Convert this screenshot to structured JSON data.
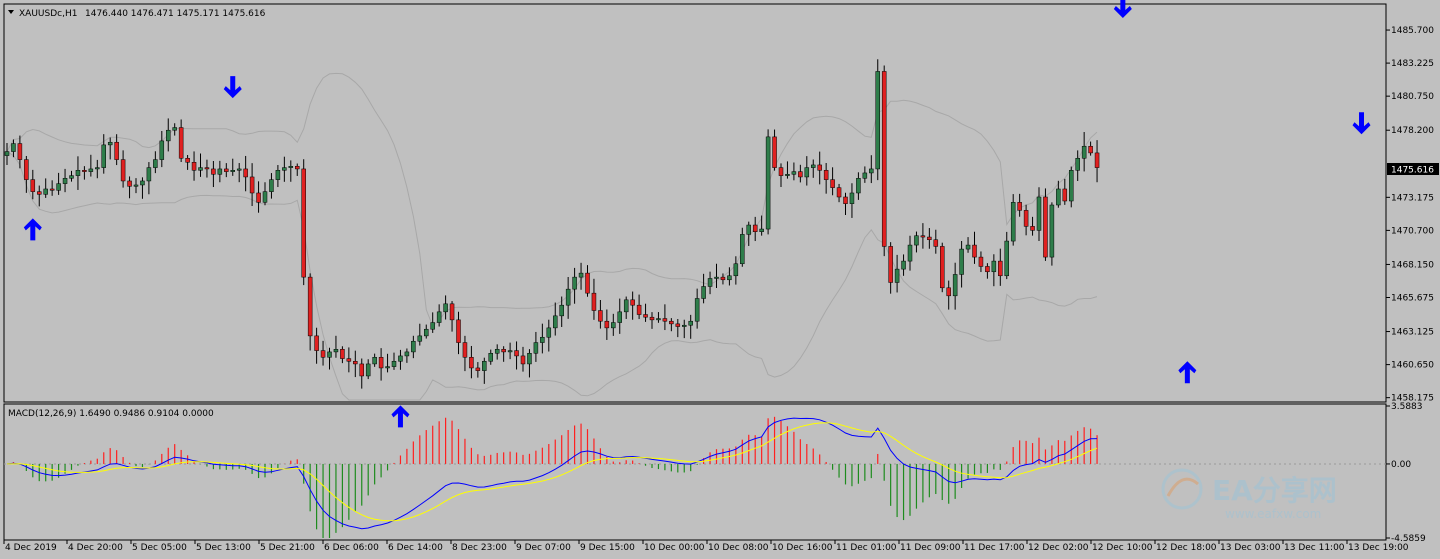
{
  "window": {
    "symbol_label": "XAUUSDc,H1",
    "ohlc_label": "1476.440 1476.471 1475.171 1475.616",
    "current_price_label": "1475.616"
  },
  "colors": {
    "background": "#c0c0c0",
    "bull_candle": "#2e7d4a",
    "bear_candle": "#e02020",
    "arrow": "#0000ff",
    "bands": "#a8a8a8",
    "macd_line": "#0000ff",
    "signal_line": "#ffff00",
    "hist_positive": "#ff2020",
    "hist_negative": "#1e8c1e"
  },
  "indicator": {
    "label": "MACD(12,26,9) 1.6490 0.9486 0.9104 0.0000"
  },
  "watermark": {
    "brand": "EA分享网",
    "url": "www.eafxw.com"
  },
  "chart_data": [
    {
      "type": "candlestick",
      "title": "XAUUSDc,H1",
      "y_ticks": [
        "1485.700",
        "1483.225",
        "1480.750",
        "1478.200",
        "1475.616",
        "1473.175",
        "1470.700",
        "1468.150",
        "1465.675",
        "1463.125",
        "1460.650",
        "1458.175"
      ],
      "ylim": [
        1458.0,
        1487.5
      ],
      "x_ticks": [
        "4 Dec 2019",
        "4 Dec 20:00",
        "5 Dec 05:00",
        "5 Dec 13:00",
        "5 Dec 21:00",
        "6 Dec 06:00",
        "6 Dec 14:00",
        "8 Dec 23:00",
        "9 Dec 07:00",
        "9 Dec 15:00",
        "10 Dec 00:00",
        "10 Dec 08:00",
        "10 Dec 16:00",
        "11 Dec 01:00",
        "11 Dec 09:00",
        "11 Dec 17:00",
        "12 Dec 02:00",
        "12 Dec 10:00",
        "12 Dec 18:00",
        "13 Dec 03:00",
        "13 Dec 11:00",
        "13 Dec 19:00"
      ],
      "closes": [
        1476.6,
        1477.2,
        1476.0,
        1474.5,
        1473.6,
        1473.4,
        1473.8,
        1473.7,
        1474.2,
        1474.6,
        1474.8,
        1475.2,
        1475.1,
        1475.3,
        1475.4,
        1477.1,
        1477.3,
        1476.0,
        1474.4,
        1474.0,
        1474.1,
        1474.4,
        1475.4,
        1476.0,
        1477.4,
        1478.2,
        1478.4,
        1476.1,
        1475.8,
        1475.2,
        1475.4,
        1475.3,
        1474.9,
        1475.3,
        1475.1,
        1475.2,
        1475.3,
        1474.7,
        1473.5,
        1472.8,
        1473.6,
        1474.5,
        1475.2,
        1475.4,
        1475.5,
        1475.3,
        1467.2,
        1462.8,
        1461.7,
        1461.2,
        1461.6,
        1461.8,
        1461.1,
        1460.9,
        1460.7,
        1459.8,
        1460.7,
        1461.2,
        1460.4,
        1460.5,
        1460.9,
        1461.3,
        1461.6,
        1462.4,
        1462.8,
        1463.3,
        1463.8,
        1464.6,
        1465.2,
        1464.0,
        1462.3,
        1461.2,
        1460.4,
        1460.2,
        1460.9,
        1461.5,
        1461.8,
        1461.6,
        1461.7,
        1461.3,
        1460.7,
        1461.5,
        1462.3,
        1462.7,
        1463.4,
        1464.3,
        1465.1,
        1466.3,
        1467.2,
        1467.5,
        1466.0,
        1464.7,
        1463.9,
        1463.4,
        1463.8,
        1464.6,
        1465.5,
        1465.1,
        1464.4,
        1464.2,
        1464.0,
        1464.1,
        1463.9,
        1463.7,
        1463.5,
        1463.6,
        1463.9,
        1465.6,
        1466.5,
        1467.1,
        1467.2,
        1467.0,
        1467.3,
        1468.2,
        1470.4,
        1471.1,
        1470.6,
        1470.8,
        1477.7,
        1475.4,
        1474.8,
        1474.9,
        1475.1,
        1474.7,
        1475.4,
        1475.6,
        1475.2,
        1474.5,
        1473.9,
        1473.2,
        1472.7,
        1473.5,
        1474.6,
        1475.0,
        1475.3,
        1482.6,
        1469.5,
        1466.8,
        1467.8,
        1468.4,
        1469.6,
        1470.3,
        1470.2,
        1470.0,
        1469.5,
        1466.4,
        1465.8,
        1467.4,
        1469.3,
        1469.6,
        1468.7,
        1468.0,
        1467.6,
        1468.4,
        1467.3,
        1469.9,
        1472.8,
        1472.2,
        1471.0,
        1470.7,
        1473.2,
        1468.7,
        1472.6,
        1473.8,
        1472.9,
        1475.2,
        1476.1,
        1477.0,
        1476.5,
        1475.4
      ],
      "arrows": [
        {
          "dir": "up",
          "bar": 4,
          "price": 1471.6
        },
        {
          "dir": "down",
          "bar": 35,
          "price": 1480.6
        },
        {
          "dir": "up",
          "bar": 61,
          "price": 1457.6
        },
        {
          "dir": "down",
          "bar": 173,
          "price": 1486.6
        },
        {
          "dir": "up",
          "bar": 183,
          "price": 1460.9
        },
        {
          "dir": "down",
          "bar": 210,
          "price": 1477.9
        }
      ]
    },
    {
      "type": "macd",
      "title": "MACD(12,26,9) 1.6490 0.9486 0.9104 0.0000",
      "params": [
        12,
        26,
        9
      ],
      "y_ticks": [
        "3.5883",
        "0.00",
        "-4.5859"
      ],
      "ylim": [
        -4.5859,
        3.5883
      ]
    }
  ]
}
